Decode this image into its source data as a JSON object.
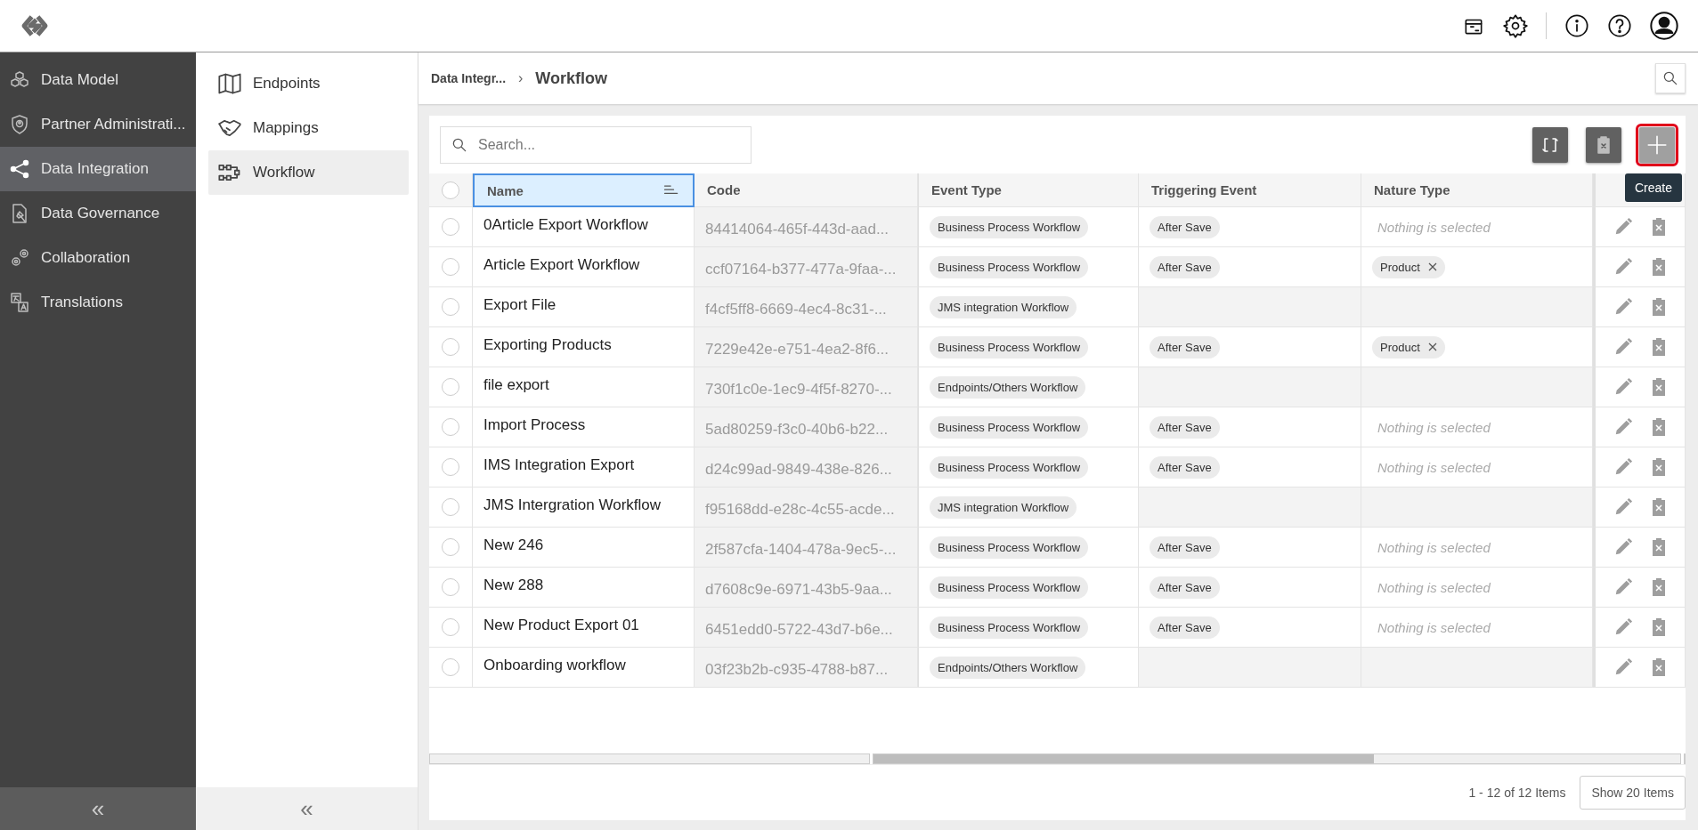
{
  "sidebar": {
    "items": [
      {
        "label": "Data Model",
        "selected": false
      },
      {
        "label": "Partner Administrati...",
        "selected": false
      },
      {
        "label": "Data Integration",
        "selected": true
      },
      {
        "label": "Data Governance",
        "selected": false
      },
      {
        "label": "Collaboration",
        "selected": false
      },
      {
        "label": "Translations",
        "selected": false
      }
    ],
    "collapse": "«"
  },
  "subnav": {
    "items": [
      {
        "label": "Endpoints",
        "selected": false
      },
      {
        "label": "Mappings",
        "selected": false
      },
      {
        "label": "Workflow",
        "selected": true
      }
    ],
    "collapse": "«"
  },
  "breadcrumb": {
    "parent": "Data Integr...",
    "separator": "›",
    "current": "Workflow"
  },
  "search": {
    "placeholder": "Search..."
  },
  "toolbar": [
    {
      "kind": "sync",
      "focused": false
    },
    {
      "kind": "delete",
      "focused": false
    },
    {
      "kind": "create",
      "focused": true,
      "tooltip": "Create"
    }
  ],
  "table": {
    "header_checked": false,
    "columns": [
      {
        "label": "Name",
        "selected": true
      },
      {
        "label": "Code",
        "selected": false
      },
      {
        "label": "Event Type",
        "selected": false
      },
      {
        "label": "Triggering Event",
        "selected": false
      },
      {
        "label": "Nature Type",
        "selected": false
      }
    ],
    "rows": [
      {
        "selected": false,
        "name": "0Article Export Workflow",
        "code": "84414064-465f-443d-aad...",
        "event_type": "Business Process Workflow",
        "trigger": "After Save",
        "nature": {
          "kind": "placeholder",
          "text": "Nothing is selected"
        }
      },
      {
        "selected": false,
        "name": "Article Export Workflow",
        "code": "ccf07164-b377-477a-9faa-...",
        "event_type": "Business Process Workflow",
        "trigger": "After Save",
        "nature": {
          "kind": "tag",
          "text": "Product"
        }
      },
      {
        "selected": false,
        "name": "Export File",
        "code": "f4cf5ff8-6669-4ec4-8c31-...",
        "event_type": "JMS integration Workflow"
      },
      {
        "selected": false,
        "name": "Exporting Products",
        "code": "7229e42e-e751-4ea2-8f6...",
        "event_type": "Business Process Workflow",
        "trigger": "After Save",
        "nature": {
          "kind": "tag",
          "text": "Product"
        }
      },
      {
        "selected": false,
        "name": "file export",
        "code": "730f1c0e-1ec9-4f5f-8270-...",
        "event_type": "Endpoints/Others Workflow"
      },
      {
        "selected": false,
        "name": "Import Process",
        "code": "5ad80259-f3c0-40b6-b22...",
        "event_type": "Business Process Workflow",
        "trigger": "After Save",
        "nature": {
          "kind": "placeholder",
          "text": "Nothing is selected"
        }
      },
      {
        "selected": false,
        "name": "IMS Integration Export",
        "code": "d24c99ad-9849-438e-826...",
        "event_type": "Business Process Workflow",
        "trigger": "After Save",
        "nature": {
          "kind": "placeholder",
          "text": "Nothing is selected"
        }
      },
      {
        "selected": false,
        "name": "JMS Intergration Workflow",
        "code": "f95168dd-e28c-4c55-acde...",
        "event_type": "JMS integration Workflow"
      },
      {
        "selected": false,
        "name": "New 246",
        "code": "2f587cfa-1404-478a-9ec5-...",
        "event_type": "Business Process Workflow",
        "trigger": "After Save",
        "nature": {
          "kind": "placeholder",
          "text": "Nothing is selected"
        }
      },
      {
        "selected": false,
        "name": "New 288",
        "code": "d7608c9e-6971-43b5-9aa...",
        "event_type": "Business Process Workflow",
        "trigger": "After Save",
        "nature": {
          "kind": "placeholder",
          "text": "Nothing is selected"
        }
      },
      {
        "selected": false,
        "name": "New Product Export 01",
        "code": "6451edd0-5722-43d7-b6e...",
        "event_type": "Business Process Workflow",
        "trigger": "After Save",
        "nature": {
          "kind": "placeholder",
          "text": "Nothing is selected"
        }
      },
      {
        "selected": false,
        "name": "Onboarding workflow",
        "code": "03f23b2b-c935-4788-b87...",
        "event_type": "Endpoints/Others Workflow"
      }
    ]
  },
  "pager": {
    "summary": "1 - 12 of 12 Items",
    "page_size_button": "Show 20 Items"
  }
}
